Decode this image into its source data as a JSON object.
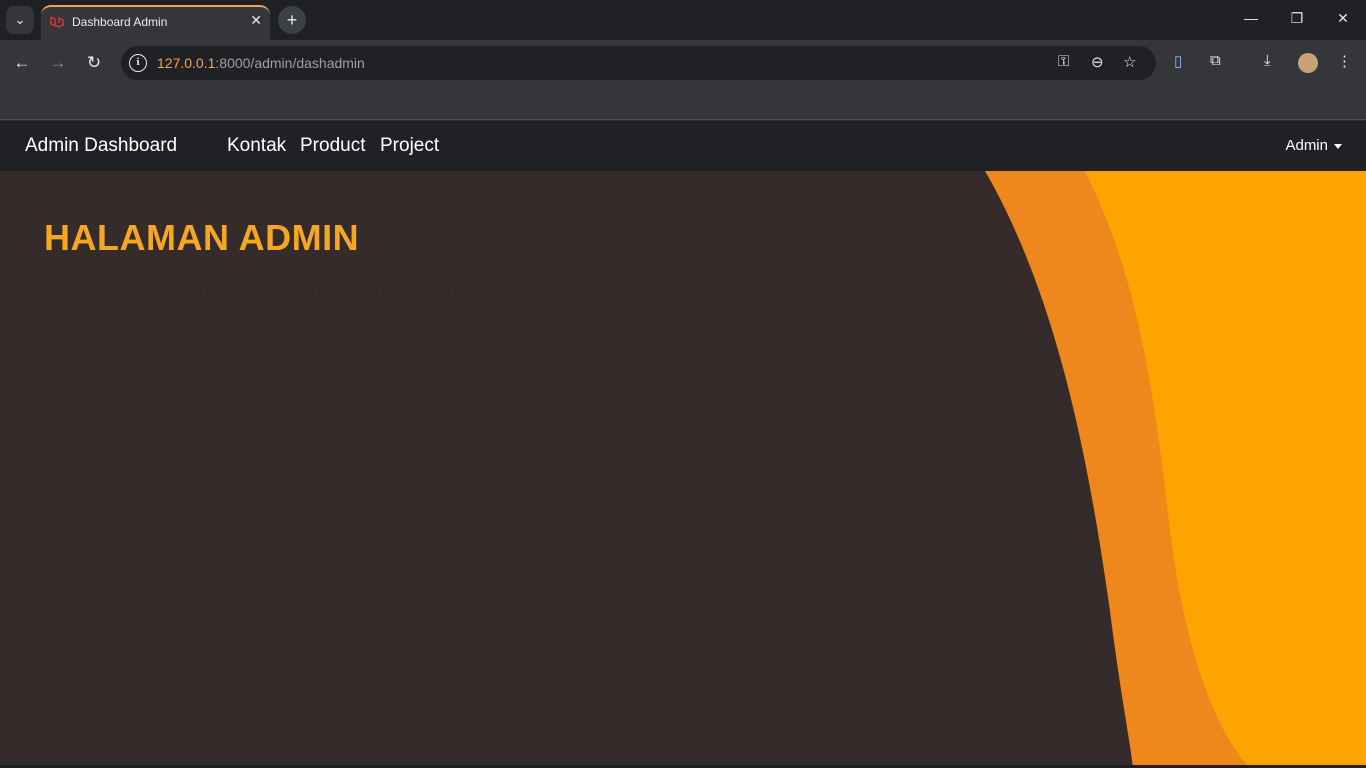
{
  "browser": {
    "tab_title": "Dashboard Admin",
    "url_host": "127.0.0.1",
    "url_path": ":8000/admin/dashadmin"
  },
  "navbar": {
    "brand": "Admin Dashboard",
    "links": [
      "Kontak",
      "Product",
      "Project"
    ],
    "user_menu": "Admin"
  },
  "hero": {
    "title": "HALAMAN ADMIN",
    "subtitle": "Selamat datang di halaman admin! Anda dapat mengelola aplikasi dari sini."
  },
  "colors": {
    "background": "#352b2a",
    "accent": "#f5a623",
    "wave_dark": "#ee871c",
    "wave_light": "#fda400"
  },
  "icons": [
    "tab-search-icon",
    "laravel-icon",
    "close-icon",
    "plus-icon",
    "minimize-icon",
    "restore-icon",
    "back-icon",
    "forward-icon",
    "reload-icon",
    "info-icon",
    "key-icon",
    "zoom-icon",
    "star-icon",
    "extension-icon",
    "download-icon",
    "menu-icon"
  ]
}
